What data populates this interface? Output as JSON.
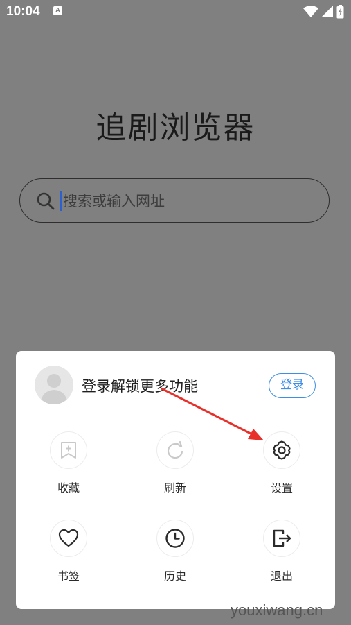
{
  "status_bar": {
    "time": "10:04",
    "notification_icon": "A"
  },
  "main": {
    "title": "追剧浏览器",
    "search": {
      "placeholder": "搜索或输入网址"
    }
  },
  "menu": {
    "login_prompt": "登录解锁更多功能",
    "login_button": "登录",
    "items": [
      {
        "label": "收藏",
        "icon": "bookmark-add-icon"
      },
      {
        "label": "刷新",
        "icon": "refresh-icon"
      },
      {
        "label": "设置",
        "icon": "gear-icon"
      },
      {
        "label": "书签",
        "icon": "heart-icon"
      },
      {
        "label": "历史",
        "icon": "clock-icon"
      },
      {
        "label": "退出",
        "icon": "exit-icon"
      }
    ]
  },
  "annotation": {
    "arrow_color": "#e8302a"
  },
  "watermark": "youxiwang.cn",
  "colors": {
    "accent": "#3d8ee6",
    "backdrop": "#808080"
  }
}
